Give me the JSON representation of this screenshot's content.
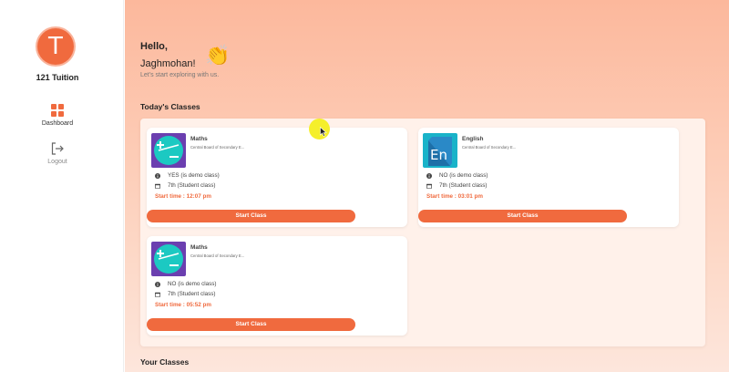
{
  "sidebar": {
    "logo_letter": "T",
    "brand": "121 Tuition",
    "items": [
      {
        "label": "Dashboard",
        "icon": "grid-icon"
      },
      {
        "label": "Logout",
        "icon": "logout-icon"
      }
    ]
  },
  "greeting": {
    "hello": "Hello,",
    "name": "Jaghmohan!",
    "emoji": "👏",
    "subtitle": "Let's start exploring with us."
  },
  "sections": {
    "today": "Today's Classes",
    "yours": "Your Classes"
  },
  "classes": [
    {
      "subject": "Maths",
      "board": "Central Board of Secondary E...",
      "demo": "YES (is demo class)",
      "student_class": "7th (Student class)",
      "start_time": "Start time : 12:07 pm",
      "button": "Start Class",
      "icon": "plus-minus-icon"
    },
    {
      "subject": "English",
      "board": "Central Board of Secondary E...",
      "demo": "NO (is demo class)",
      "student_class": "7th (Student class)",
      "start_time": "Start time : 03:01 pm",
      "button": "Start Class",
      "icon": "en-book-icon"
    },
    {
      "subject": "Maths",
      "board": "Central Board of Secondary E...",
      "demo": "NO (is demo class)",
      "student_class": "7th (Student class)",
      "start_time": "Start time : 05:52 pm",
      "button": "Start Class",
      "icon": "plus-minus-icon"
    }
  ],
  "colors": {
    "accent": "#f06a3e",
    "background_top": "#fcb89c",
    "background_bottom": "#fde6dc"
  }
}
